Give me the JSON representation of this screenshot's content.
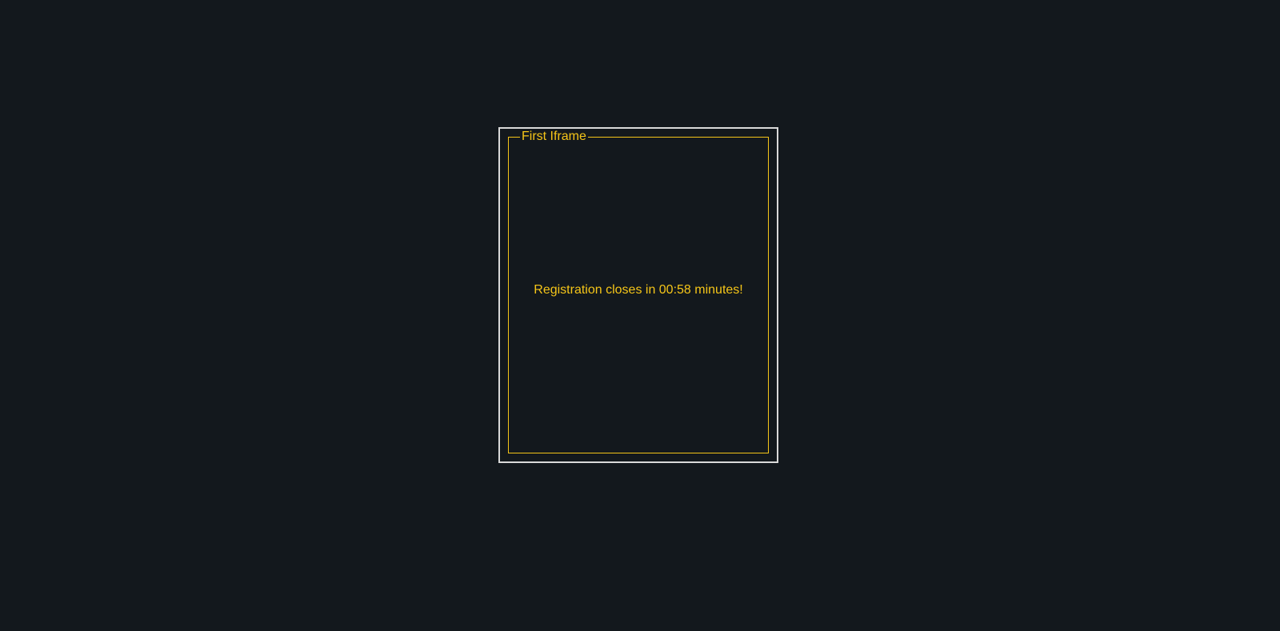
{
  "theme": {
    "background": "#13181d",
    "frame_border": "#d9d9d9",
    "accent": "#f5c518"
  },
  "iframe": {
    "legend": "First Iframe",
    "message": "Registration closes in 00:58 minutes!"
  }
}
